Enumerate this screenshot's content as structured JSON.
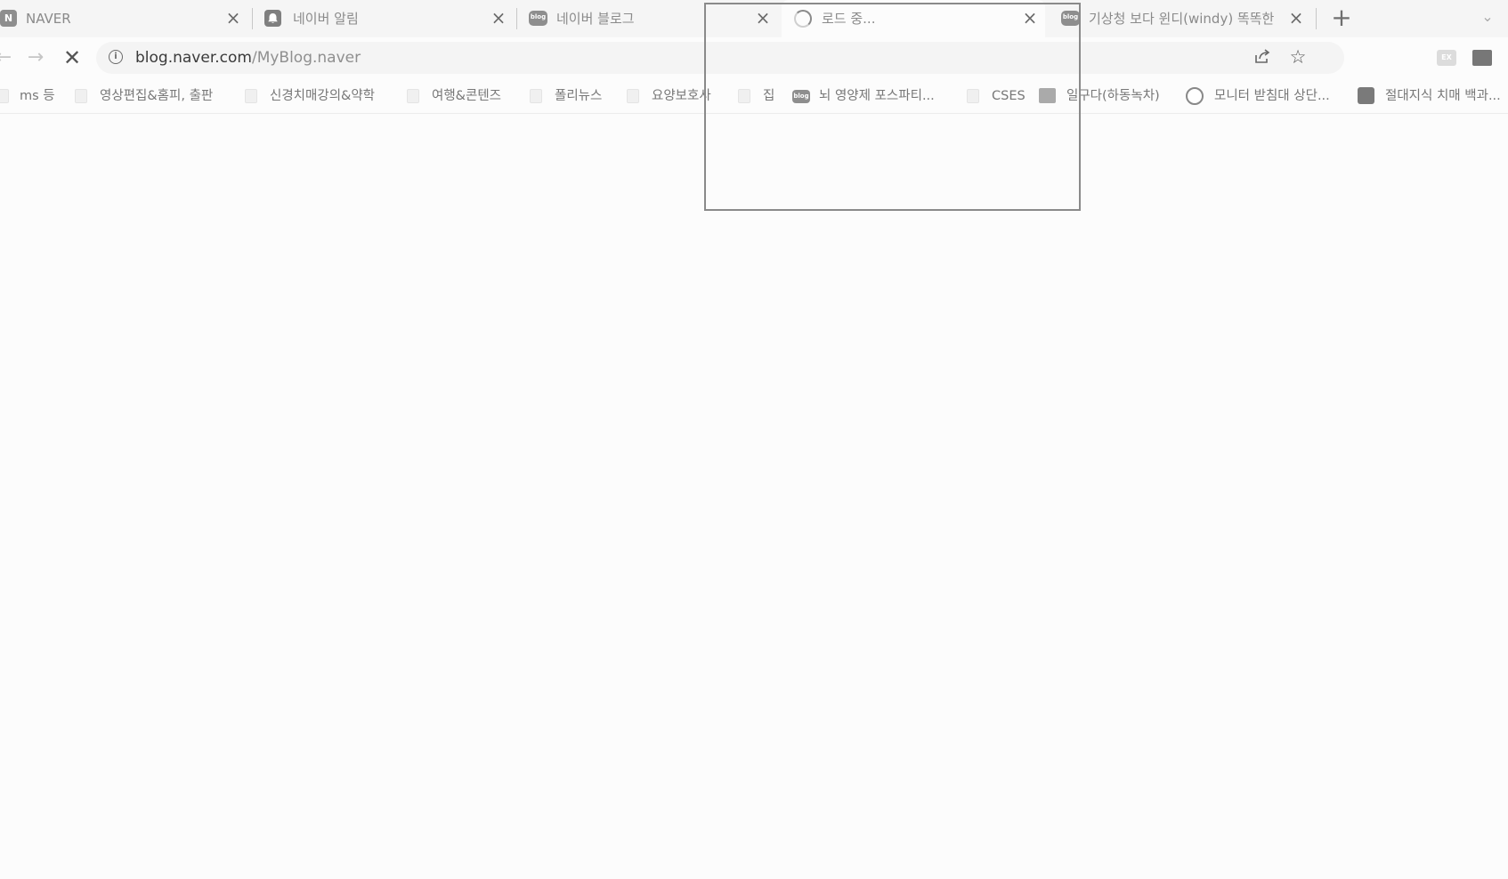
{
  "tabs": [
    {
      "favicon": "naver-logo-icon",
      "favicon_text": "N",
      "label": "NAVER",
      "close": "×"
    },
    {
      "favicon": "bell-icon",
      "favicon_text": "",
      "label": "네이버 알림",
      "close": "×"
    },
    {
      "favicon": "blog-icon",
      "favicon_text": "blog",
      "label": "네이버 블로그",
      "close": "×"
    },
    {
      "favicon": "loading-spinner-icon",
      "favicon_text": "",
      "label": "로드 중...",
      "close": "×"
    },
    {
      "favicon": "blog-icon",
      "favicon_text": "blog",
      "label": "기상청 보다 윈디(windy) 똑똑한",
      "close": "×"
    }
  ],
  "new_tab": "+",
  "tab_search": "⌄",
  "toolbar": {
    "back": "←",
    "forward": "→",
    "stop": "✕",
    "info": "i",
    "url_host": "blog.naver.com",
    "url_path": "/MyBlog.naver",
    "share": "⇪",
    "star": "☆"
  },
  "extensions": [
    {
      "name": "ex-extension-icon",
      "text": "EX"
    },
    {
      "name": "dark-extension-icon",
      "text": ""
    }
  ],
  "bookmarks": [
    {
      "icon": "folder-icon",
      "label": "ms 등"
    },
    {
      "icon": "folder-icon",
      "label": "영상편집&홈피, 출판"
    },
    {
      "icon": "folder-icon",
      "label": "신경치매강의&약학"
    },
    {
      "icon": "folder-icon",
      "label": "여행&콘텐즈"
    },
    {
      "icon": "folder-icon",
      "label": "폴리뉴스"
    },
    {
      "icon": "folder-icon",
      "label": "요양보호사"
    },
    {
      "icon": "folder-icon",
      "label": "집"
    },
    {
      "icon": "blog-icon",
      "label": "뇌 영양제 포스파티..."
    },
    {
      "icon": "folder-icon",
      "label": "CSES"
    },
    {
      "icon": "gray-square-icon",
      "label": "일구다(하동녹차)"
    },
    {
      "icon": "emblem-icon",
      "label": "모니터 받침대 상단..."
    },
    {
      "icon": "dark-square-icon",
      "label": "절대지식 치매 백과..."
    }
  ]
}
